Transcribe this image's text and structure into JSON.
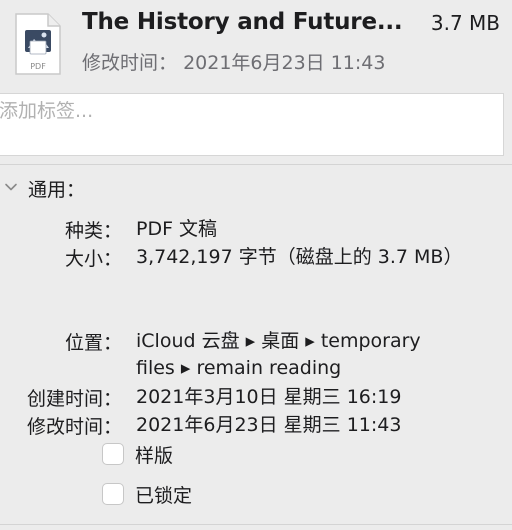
{
  "header": {
    "title": "The History and Future...",
    "size": "3.7 MB",
    "modified_label": "修改时间：",
    "modified_value": "2021年6月23日 11:43",
    "file_type_badge": "PDF",
    "icon": "pdf-document-icon"
  },
  "tags": {
    "placeholder": "添加标签..."
  },
  "general": {
    "title": "通用：",
    "icon": "chevron-down-icon",
    "rows": [
      {
        "label": "种类：",
        "value": "PDF 文稿"
      },
      {
        "label": "大小：",
        "value": "3,742,197 字节（磁盘上的 3.7 MB）"
      },
      {
        "label": "位置：",
        "value": "iCloud 云盘 ▸ 桌面 ▸ temporary files ▸ remain reading"
      },
      {
        "label": "创建时间：",
        "value": "2021年3月10日 星期三 16:19"
      },
      {
        "label": "修改时间：",
        "value": "2021年6月23日 星期三 11:43"
      }
    ],
    "checkboxes": [
      {
        "label": "样版",
        "checked": false
      },
      {
        "label": "已锁定",
        "checked": false
      }
    ]
  }
}
